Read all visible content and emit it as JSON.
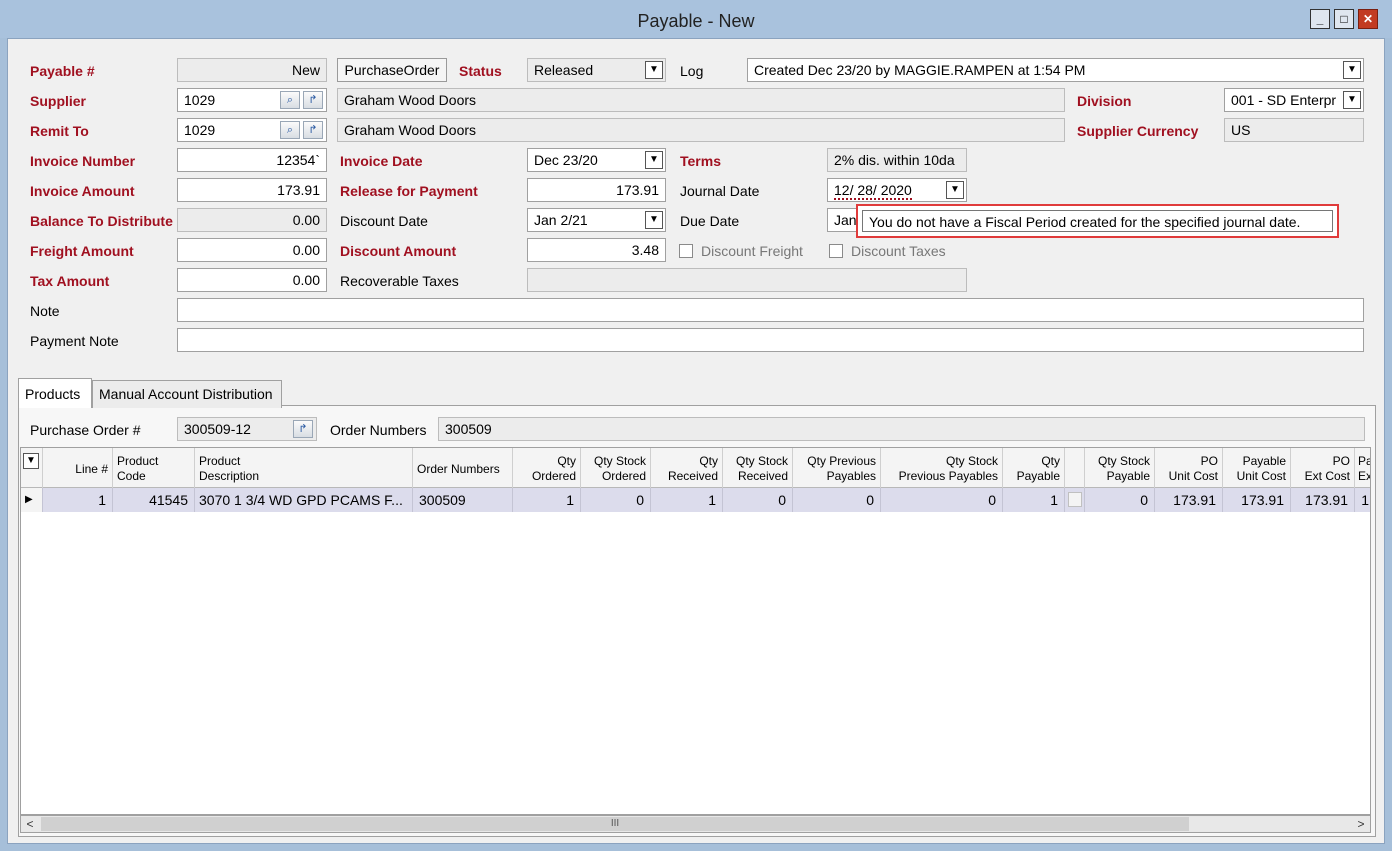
{
  "window": {
    "title": "Payable - New",
    "min": "_",
    "max": "□",
    "close": "✕"
  },
  "form": {
    "payable_no": {
      "label": "Payable #",
      "value": "New"
    },
    "purchase_order_button": "PurchaseOrder",
    "status": {
      "label": "Status",
      "value": "Released"
    },
    "log": {
      "label": "Log",
      "value": "Created Dec 23/20 by MAGGIE.RAMPEN at 1:54 PM"
    },
    "supplier": {
      "label": "Supplier",
      "code": "1029",
      "name": "Graham Wood Doors"
    },
    "division": {
      "label": "Division",
      "value": "001 - SD Enterpr"
    },
    "remit_to": {
      "label": "Remit To",
      "code": "1029",
      "name": "Graham Wood Doors"
    },
    "supplier_currency": {
      "label": "Supplier Currency",
      "value": "US"
    },
    "invoice_number": {
      "label": "Invoice Number",
      "value": "12354`"
    },
    "invoice_date": {
      "label": "Invoice Date",
      "value": "Dec 23/20"
    },
    "terms": {
      "label": "Terms",
      "value": "2% dis. within 10da"
    },
    "invoice_amount": {
      "label": "Invoice Amount",
      "value": "173.91"
    },
    "release_for_payment": {
      "label": "Release for Payment",
      "value": "173.91"
    },
    "journal_date": {
      "label": "Journal Date",
      "value": "12/ 28/ 2020"
    },
    "balance_to_distribute": {
      "label": "Balance To Distribute",
      "value": "0.00"
    },
    "discount_date": {
      "label": "Discount Date",
      "value": "Jan 2/21"
    },
    "due_date": {
      "label": "Due Date",
      "value": "Jan 2"
    },
    "freight_amount": {
      "label": "Freight Amount",
      "value": "0.00"
    },
    "discount_amount": {
      "label": "Discount Amount",
      "value": "3.48"
    },
    "discount_freight": {
      "label": "Discount Freight"
    },
    "discount_taxes": {
      "label": "Discount Taxes"
    },
    "tax_amount": {
      "label": "Tax Amount",
      "value": "0.00"
    },
    "recoverable_taxes": {
      "label": "Recoverable Taxes",
      "value": ""
    },
    "note": {
      "label": "Note",
      "value": ""
    },
    "payment_note": {
      "label": "Payment Note",
      "value": ""
    }
  },
  "tooltip": "You do not have a Fiscal Period created for the specified journal date.",
  "tabs": [
    {
      "label": "Products",
      "active": true
    },
    {
      "label": "Manual Account Distribution",
      "active": false
    }
  ],
  "products": {
    "po_label": "Purchase Order #",
    "po_value": "300509-12",
    "order_numbers_label": "Order Numbers",
    "order_numbers_value": "300509",
    "columns": [
      [
        "Line #",
        ""
      ],
      [
        "Product",
        "Code"
      ],
      [
        "Product",
        "Description"
      ],
      [
        "Order Numbers",
        ""
      ],
      [
        "Qty",
        "Ordered"
      ],
      [
        "Qty Stock",
        "Ordered"
      ],
      [
        "Qty",
        "Received"
      ],
      [
        "Qty Stock",
        "Received"
      ],
      [
        "Qty Previous",
        "Payables"
      ],
      [
        "Qty Stock",
        "Previous Payables"
      ],
      [
        "Qty",
        "Payable"
      ],
      [
        "Qty Stock",
        "Payable"
      ],
      [
        "PO",
        "Unit Cost"
      ],
      [
        "Payable",
        "Unit Cost"
      ],
      [
        "PO",
        "Ext Cost"
      ],
      [
        "Pa",
        "Ex"
      ]
    ],
    "rows": [
      [
        "1",
        "41545",
        "3070 1 3/4 WD GPD PCAMS F...",
        "300509",
        "1",
        "0",
        "1",
        "0",
        "0",
        "0",
        "1",
        "0",
        "173.91",
        "173.91",
        "173.91",
        "1"
      ]
    ],
    "scroll_thumb": "III"
  }
}
